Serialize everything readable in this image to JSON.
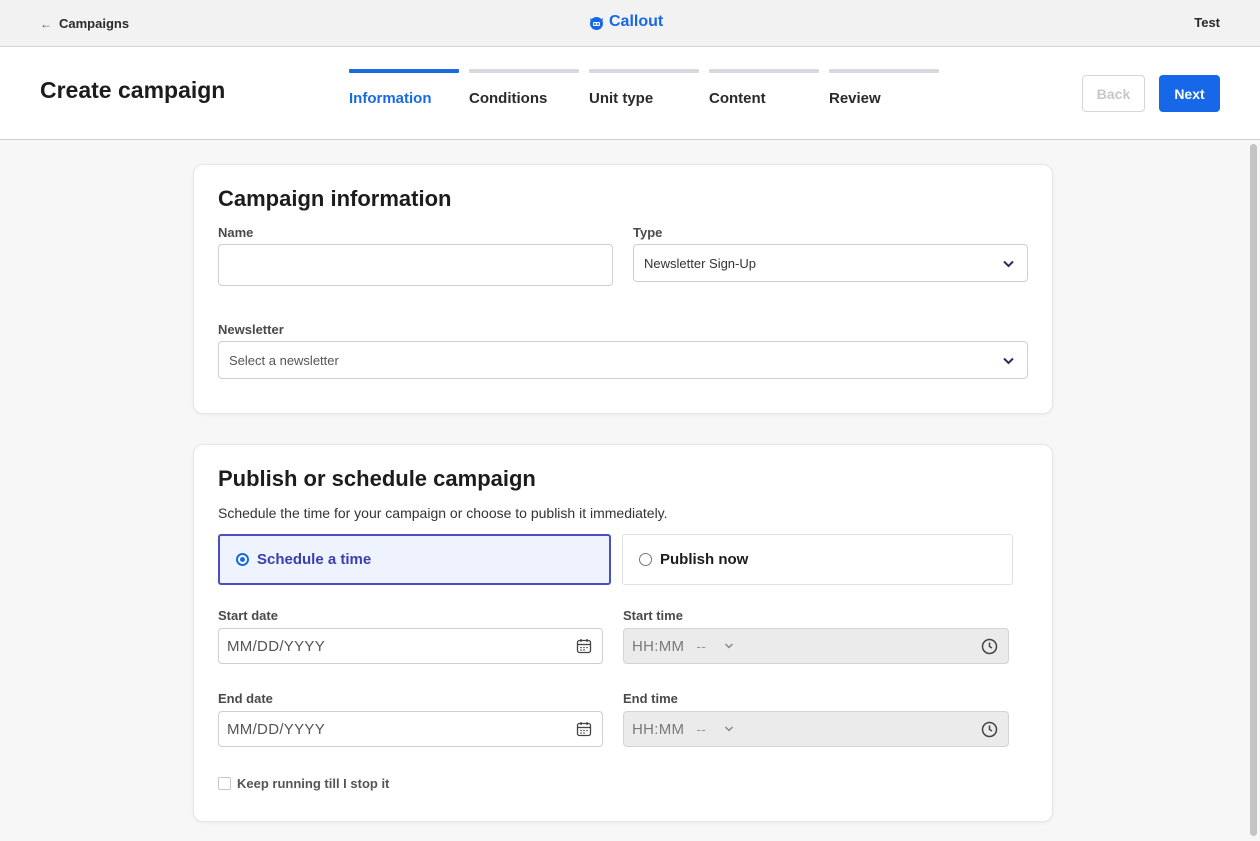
{
  "topbar": {
    "back_label": "Campaigns",
    "brand_name": "Callout",
    "user_name": "Test",
    "brand_color": "#1668e8"
  },
  "header": {
    "title": "Create campaign",
    "steps": [
      {
        "label": "Information",
        "active": true
      },
      {
        "label": "Conditions",
        "active": false
      },
      {
        "label": "Unit type",
        "active": false
      },
      {
        "label": "Content",
        "active": false
      },
      {
        "label": "Review",
        "active": false
      }
    ],
    "back_button": "Back",
    "next_button": "Next"
  },
  "campaign_info": {
    "heading": "Campaign information",
    "name_label": "Name",
    "name_value": "",
    "type_label": "Type",
    "type_value": "Newsletter Sign-Up",
    "newsletter_label": "Newsletter",
    "newsletter_placeholder": "Select a newsletter"
  },
  "schedule": {
    "heading": "Publish or schedule campaign",
    "description": "Schedule the time for your campaign or choose to publish it immediately.",
    "option_schedule": "Schedule a time",
    "option_publish": "Publish now",
    "selected_option": "Schedule a time",
    "start_date_label": "Start date",
    "start_date_placeholder": "MM/DD/YYYY",
    "start_time_label": "Start time",
    "start_time_placeholder": "HH:MM",
    "start_time_ampm": "--",
    "end_date_label": "End date",
    "end_date_placeholder": "MM/DD/YYYY",
    "end_time_label": "End time",
    "end_time_placeholder": "HH:MM",
    "end_time_ampm": "--",
    "keep_running_label": "Keep running till I stop it",
    "keep_running_checked": false
  }
}
